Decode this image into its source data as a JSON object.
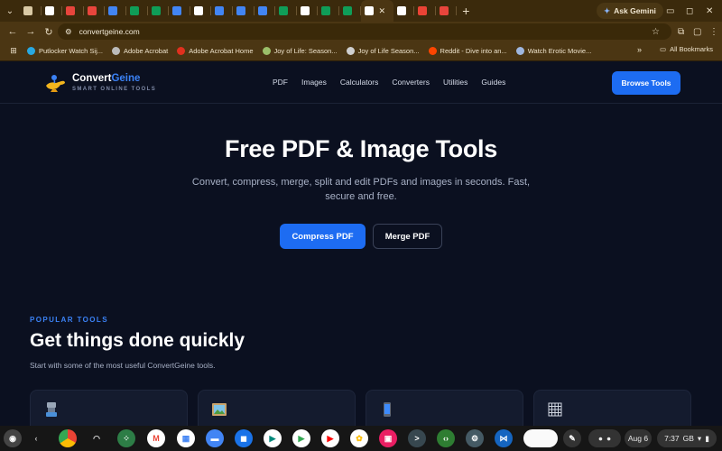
{
  "browser": {
    "tab_icons": [
      "download-icon",
      "doc-icon",
      "pdf-icon",
      "pdf-icon",
      "chart-icon",
      "sheets-icon",
      "sheets-icon",
      "chart-icon",
      "github-icon",
      "drive-icon",
      "google-icon",
      "google-icon",
      "sheets-icon",
      "acrobat-icon",
      "sheets-icon",
      "sheets-icon",
      "acrobat-icon",
      "acrobat-icon",
      "gmail-icon",
      "pdf-icon"
    ],
    "tab_colors": [
      "#d9c9a5",
      "#ffffff",
      "#e8453c",
      "#e8453c",
      "#4285f4",
      "#0f9d58",
      "#0f9d58",
      "#4285f4",
      "#ffffff",
      "#4285f4",
      "#4285f4",
      "#4285f4",
      "#0f9d58",
      "#ffffff",
      "#0f9d58",
      "#0f9d58",
      "#ffffff",
      "#ffffff",
      "#ea4335",
      "#e8453c"
    ],
    "ask_gemini": "Ask Gemini",
    "url": "convertgeine.com",
    "bookmarks": [
      {
        "label": "Putlocker Watch Sij...",
        "color": "#29a9e1"
      },
      {
        "label": "Adobe Acrobat",
        "color": "#bbbbbb"
      },
      {
        "label": "Adobe Acrobat Home",
        "color": "#e0301e"
      },
      {
        "label": "Joy of Life: Season...",
        "color": "#9bbf6a"
      },
      {
        "label": "Joy of Life Season...",
        "color": "#cfcfcf"
      },
      {
        "label": "Reddit - Dive into an...",
        "color": "#ff4500"
      },
      {
        "label": "Watch Erotic Movie...",
        "color": "#9fb7e0"
      }
    ],
    "all_bookmarks": "All Bookmarks"
  },
  "site": {
    "brand_prefix": "Convert",
    "brand_accent": "Geine",
    "tagline": "SMART ONLINE TOOLS",
    "nav": [
      "PDF",
      "Images",
      "Calculators",
      "Converters",
      "Utilities",
      "Guides"
    ],
    "browse_tools": "Browse Tools",
    "hero": {
      "title": "Free PDF & Image Tools",
      "subtitle": "Convert, compress, merge, split and edit PDFs and images in seconds. Fast, secure and free.",
      "primary_cta": "Compress PDF",
      "secondary_cta": "Merge PDF"
    },
    "popular": {
      "eyebrow": "POPULAR TOOLS",
      "title": "Get things done quickly",
      "subtitle": "Start with some of the most useful ConvertGeine tools.",
      "card_icons": [
        "compress-icon",
        "image-icon",
        "mobile-icon",
        "grid-icon"
      ]
    },
    "accent_color": "#1d6cf2"
  },
  "shelf": {
    "date": "Aug 6",
    "time": "7:37",
    "region": "GB"
  }
}
